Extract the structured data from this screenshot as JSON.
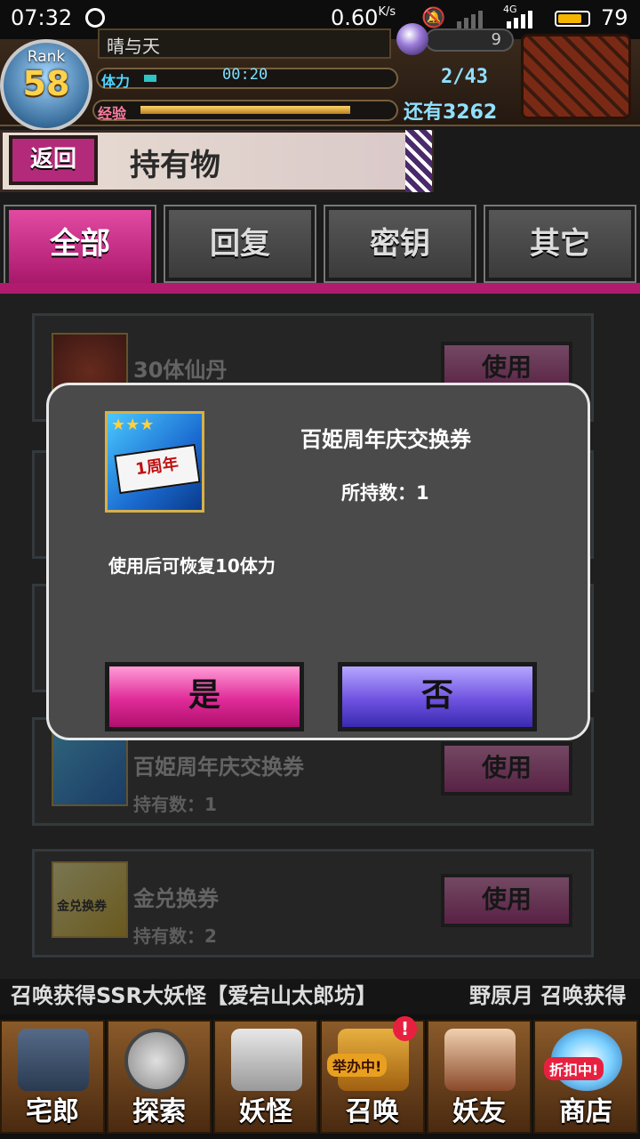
{
  "status_bar": {
    "time": "07:32",
    "speed_value": "0.60",
    "speed_unit": "K/s",
    "network_label": "4G",
    "battery": "79"
  },
  "header": {
    "rank_label": "Rank",
    "rank_value": "58",
    "player_name": "晴与天",
    "orb_count": "9",
    "stamina_label": "体力",
    "stamina_timer": "00:20",
    "stamina_value": "2/43",
    "exp_label": "经验",
    "exp_remaining": "还有3262"
  },
  "title_bar": {
    "back_label": "返回",
    "title": "持有物"
  },
  "tabs": [
    {
      "label": "全部",
      "active": true
    },
    {
      "label": "回复",
      "active": false
    },
    {
      "label": "密钥",
      "active": false
    },
    {
      "label": "其它",
      "active": false
    }
  ],
  "items": [
    {
      "name": "30体仙丹",
      "qty": "",
      "use_label": "使用"
    },
    {
      "name": "百姫周年庆交换券",
      "qty": "持有数：1",
      "use_label": "使用"
    },
    {
      "name": "金兑换券",
      "qty": "持有数：2",
      "use_label": "使用",
      "icon_text": "金兑换券"
    }
  ],
  "dialog": {
    "item_name": "百姫周年庆交换券",
    "owned": "所持数：1",
    "description": "使用后可恢复10体力",
    "icon_text": "1周年",
    "stars": "★★★",
    "yes_label": "是",
    "no_label": "否"
  },
  "ticker": {
    "text1": "召唤获得SSR大妖怪【爱宕山太郎坊】",
    "text2": "野原月 召唤获得"
  },
  "bottom_nav": [
    {
      "label": "宅郎"
    },
    {
      "label": "探索"
    },
    {
      "label": "妖怪"
    },
    {
      "label": "召唤",
      "badge": "举办中!",
      "alert": "!"
    },
    {
      "label": "妖友"
    },
    {
      "label": "商店",
      "badge": "折扣中!"
    }
  ]
}
